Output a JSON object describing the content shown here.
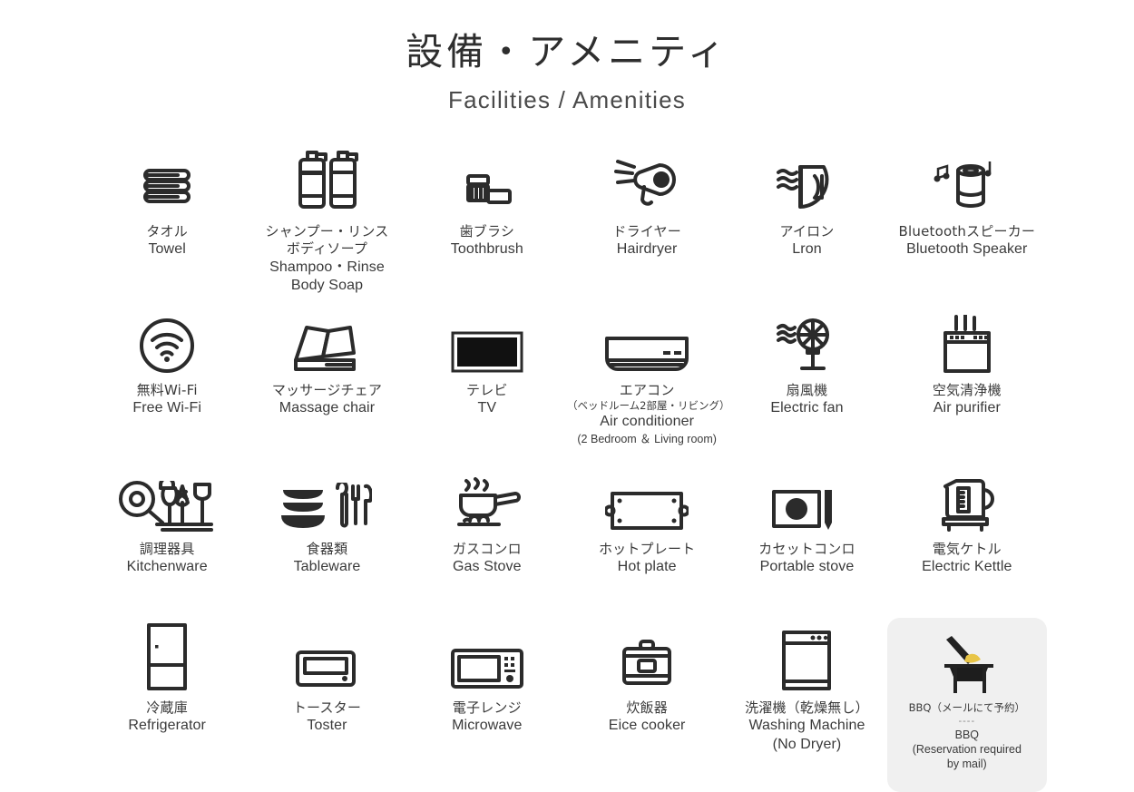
{
  "header": {
    "title_ja": "設備・アメニティ",
    "title_en": "Facilities / Amenities"
  },
  "items": [
    {
      "icon": "towel-icon",
      "ja": "タオル",
      "en": "Towel"
    },
    {
      "icon": "shampoo-bottles-icon",
      "ja": "シャンプー・リンス",
      "ja2": "ボディソープ",
      "en": "Shampoo・Rinse",
      "en2": "Body Soap"
    },
    {
      "icon": "toothbrush-icon",
      "ja": "歯ブラシ",
      "en": "Toothbrush"
    },
    {
      "icon": "hairdryer-icon",
      "ja": "ドライヤー",
      "en": "Hairdryer"
    },
    {
      "icon": "iron-icon",
      "ja": "アイロン",
      "en": "Lron"
    },
    {
      "icon": "bluetooth-speaker-icon",
      "ja": "Bluetoothスピーカー",
      "en": "Bluetooth Speaker"
    },
    {
      "icon": "wifi-icon",
      "ja": "無料Wi-Fi",
      "en": "Free Wi-Fi"
    },
    {
      "icon": "massage-chair-icon",
      "ja": "マッサージチェア",
      "en": "Massage chair"
    },
    {
      "icon": "tv-icon",
      "ja": "テレビ",
      "en": "TV"
    },
    {
      "icon": "air-conditioner-icon",
      "ja": "エアコン",
      "ja_sub": "（ベッドルーム2部屋・リビング）",
      "en": "Air conditioner",
      "en_sub": "(2 Bedroom ＆ Living room)"
    },
    {
      "icon": "electric-fan-icon",
      "ja": "扇風機",
      "en": "Electric fan"
    },
    {
      "icon": "air-purifier-icon",
      "ja": "空気清浄機",
      "en": "Air purifier"
    },
    {
      "icon": "kitchenware-icon",
      "ja": "調理器具",
      "en": "Kitchenware"
    },
    {
      "icon": "tableware-icon",
      "ja": "食器類",
      "en": "Tableware"
    },
    {
      "icon": "gas-stove-icon",
      "ja": "ガスコンロ",
      "en": "Gas Stove"
    },
    {
      "icon": "hot-plate-icon",
      "ja": "ホットプレート",
      "en": "Hot plate"
    },
    {
      "icon": "portable-stove-icon",
      "ja": "カセットコンロ",
      "en": "Portable stove"
    },
    {
      "icon": "electric-kettle-icon",
      "ja": "電気ケトル",
      "en": "Electric Kettle"
    },
    {
      "icon": "refrigerator-icon",
      "ja": "冷蔵庫",
      "en": "Refrigerator"
    },
    {
      "icon": "toaster-icon",
      "ja": "トースター",
      "en": "Toster"
    },
    {
      "icon": "microwave-icon",
      "ja": "電子レンジ",
      "en": "Microwave"
    },
    {
      "icon": "rice-cooker-icon",
      "ja": "炊飯器",
      "en": "Eice cooker"
    },
    {
      "icon": "washing-machine-icon",
      "ja": "洗濯機（乾燥無し）",
      "en": "Washing Machine",
      "en2": "(No Dryer)"
    },
    {
      "icon": "bbq-grill-icon",
      "ja": "BBQ（メールにて予約）",
      "sep": "----",
      "en": "BBQ",
      "en2": "(Reservation required",
      "en3": "by mail)",
      "highlight": true
    }
  ],
  "colors": {
    "background": "#ffffff",
    "text": "#3a3a3a",
    "icon_stroke": "#2b2b2b",
    "card_background": "#f0f0f0",
    "bbq_flame": "#e8c547"
  }
}
